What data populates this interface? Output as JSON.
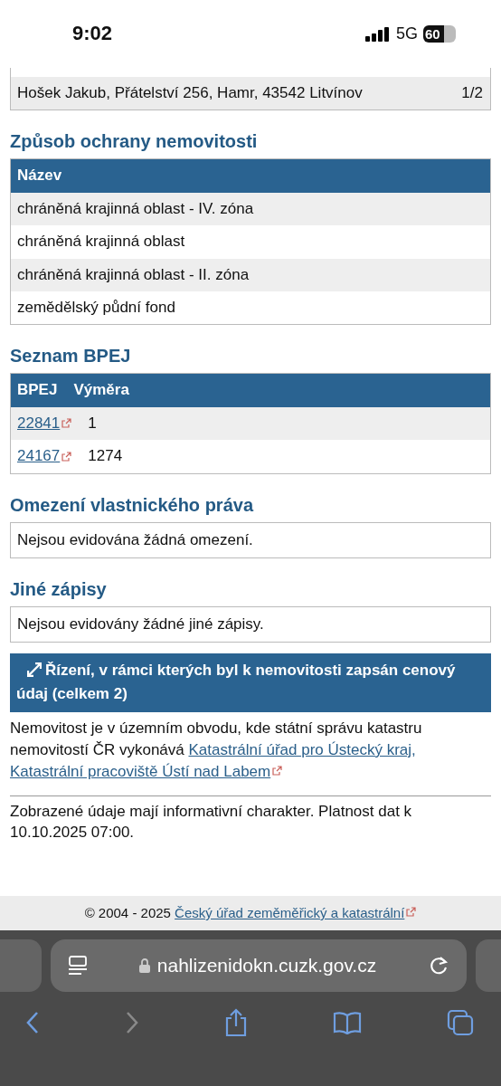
{
  "status_bar": {
    "time": "9:02",
    "network": "5G",
    "battery": "60"
  },
  "owners_table": {
    "rows": [
      {
        "owner": "Hošek Jakub, Přátelství 256, Hamr, 43542 Litvínov",
        "share": "1/2"
      }
    ]
  },
  "protection": {
    "title": "Způsob ochrany nemovitosti",
    "columns": [
      "Název"
    ],
    "rows": [
      {
        "cells": [
          "chráněná krajinná oblast - IV. zóna"
        ]
      },
      {
        "cells": [
          "chráněná krajinná oblast"
        ]
      },
      {
        "cells": [
          "chráněná krajinná oblast - II. zóna"
        ]
      },
      {
        "cells": [
          "zemědělský půdní fond"
        ]
      }
    ]
  },
  "bpej": {
    "title": "Seznam BPEJ",
    "columns": [
      "BPEJ",
      "Výměra"
    ],
    "rows": [
      {
        "code": "22841",
        "area": "1"
      },
      {
        "code": "24167",
        "area": "1274"
      }
    ]
  },
  "restrictions": {
    "title": "Omezení vlastnického práva",
    "text": "Nejsou evidována žádná omezení."
  },
  "other_records": {
    "title": "Jiné zápisy",
    "text": "Nejsou evidovány žádné jiné zápisy."
  },
  "proceedings": {
    "label": "Řízení, v rámci kterých byl k nemovitosti zapsán cenový údaj (celkem 2)"
  },
  "office_note": {
    "text": "Nemovitost je v územním obvodu, kde státní správu katastru nemovitostí ČR vykonává",
    "link_lines": [
      "Katastrální úřad pro Ústecký kraj,",
      "Katastrální pracoviště Ústí nad Labem"
    ]
  },
  "disclaimer": "Zobrazené údaje mají informativní charakter. Platnost dat k 10.10.2025 07:00.",
  "footer": {
    "copyright": "© 2004 - 2025",
    "link": "Český úřad zeměměřický a katastrální"
  },
  "browser": {
    "url": "nahlizenidokn.cuzk.gov.cz",
    "buttons": [
      {
        "kind": "back",
        "disabled": false
      },
      {
        "kind": "forward",
        "disabled": true
      },
      {
        "kind": "share",
        "disabled": false
      },
      {
        "kind": "bookmarks",
        "disabled": false
      },
      {
        "kind": "tabs",
        "disabled": false
      }
    ]
  }
}
